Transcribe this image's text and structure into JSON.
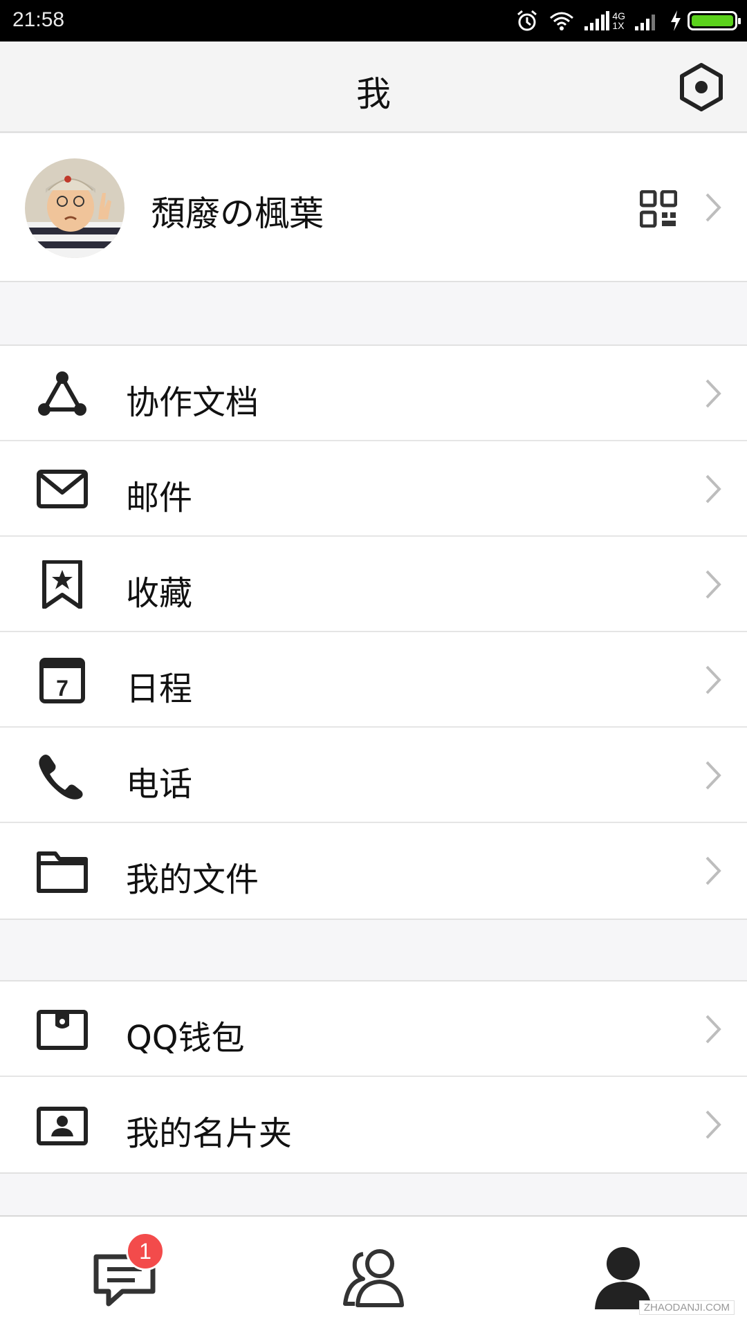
{
  "status_bar": {
    "time": "21:58",
    "network_top": "4G",
    "network_bottom": "1X",
    "icons": [
      "alarm-icon",
      "wifi-icon",
      "signal-icon",
      "signal-icon",
      "charging-icon",
      "battery-icon"
    ],
    "battery_level": 1.0,
    "battery_color": "#5ad11b"
  },
  "header": {
    "title": "我",
    "settings_icon": "settings-hexagon-icon"
  },
  "profile": {
    "name": "頹廢の楓葉",
    "qr_icon": "qr-code-icon"
  },
  "menu_group_1": [
    {
      "label": "协作文档",
      "icon": "share-triangle-icon"
    },
    {
      "label": "邮件",
      "icon": "mail-icon"
    },
    {
      "label": "收藏",
      "icon": "bookmark-star-icon"
    },
    {
      "label": "日程",
      "icon": "calendar-icon"
    },
    {
      "label": "电话",
      "icon": "phone-icon"
    },
    {
      "label": "我的文件",
      "icon": "folder-icon"
    }
  ],
  "calendar_day": "7",
  "menu_group_2": [
    {
      "label": "QQ钱包",
      "icon": "wallet-icon"
    },
    {
      "label": "我的名片夹",
      "icon": "business-card-icon"
    }
  ],
  "tabbar": {
    "tabs": [
      {
        "icon": "messages-icon"
      },
      {
        "icon": "contacts-icon"
      },
      {
        "icon": "profile-icon"
      }
    ],
    "messages_badge": "1",
    "badge_color": "#f34b4b"
  },
  "watermark": "ZHAODANJI.COM"
}
